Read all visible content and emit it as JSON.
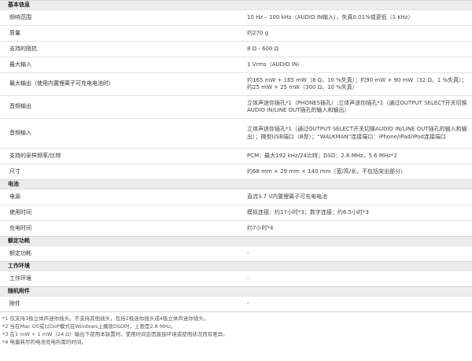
{
  "sections": [
    {
      "title": "基本信息",
      "rows": [
        {
          "label": "频响范围",
          "value": "10 Hz – 100 kHz（AUDIO IN输入），失真0.01%或更低（1 kHz）",
          "h": 20
        },
        {
          "label": "质量",
          "value": "约270 g",
          "h": 20
        },
        {
          "label": "支持的阻抗",
          "value": "8 Ω - 600 Ω",
          "h": 20
        },
        {
          "label": "最大输入",
          "value": "1 Vrms（AUDIO IN）",
          "h": 20
        },
        {
          "label": "最大输出（使用内置锂离子可充电电池时）",
          "value": "约165 mW + 165 mW（8 Ω，10 %失真）；约90 mW + 90 mW（32 Ω，1 %失真）；约25 mW + 25 mW（300 Ω，10 %失真）",
          "h": 29
        },
        {
          "label": "音频输出",
          "value": "立体声迷你插孔*1（PHONES插孔）;立体声迷你插孔*1（通过OUTPUT SELECT开关切换AUDIO IN/LINE OUT插孔的输入和输出）",
          "h": 29
        },
        {
          "label": "音频输入",
          "value": "立体声迷你插孔*1（通过OUTPUT SELECT开关切换AUDIO IN/LINE OUT插孔的输入和输出）；微型USB端口（B型）；“WALKMAN”连接端口：iPhone/iPad/iPod连接端口",
          "h": 38
        },
        {
          "label": "支持的采样频率/比特",
          "value": "PCM：最大192 kHz/24比特；DSD：2.8 MHz，5.6 MHz*2",
          "h": 20
        },
        {
          "label": "尺寸",
          "value": "约68 mm × 29 mm × 140 mm（宽/高/长，不包括突出部分）",
          "h": 20
        }
      ]
    },
    {
      "title": "电池",
      "rows": [
        {
          "label": "电源",
          "value": "直流3.7 V内置锂离子可充电电池",
          "h": 20
        },
        {
          "label": "使用时间",
          "value": "模拟连接：约17小时*3；数字连接：约6.5小时*3",
          "h": 20
        },
        {
          "label": "充电时间",
          "value": "约7小时*4",
          "h": 20
        }
      ]
    },
    {
      "title": "额定功耗",
      "rows": [
        {
          "label": "额定功耗",
          "value": "-",
          "h": 20
        }
      ]
    },
    {
      "title": "工作环境",
      "rows": [
        {
          "label": "工作环境",
          "value": "-",
          "h": 20
        }
      ]
    },
    {
      "title": "随机附件",
      "rows": [
        {
          "label": "附件",
          "value": "-",
          "h": 20
        }
      ]
    }
  ],
  "footnotes": [
    "*1 仅支持3极立体声迷你插头。不支持其他插头，包括2极迷你插头或4极立体声迷你插头。",
    "*2 当在Mac OS或以DoP模式在Windows上播放DSD时，上限是2.8 MHz。",
    "*3 在1 mW + 1 mW（24 Ω）输出下使用本装置时。使用时间会因直接环境或使用状况而有差异。",
    "*4 电量耗尽的电池充电所需的时间。"
  ]
}
